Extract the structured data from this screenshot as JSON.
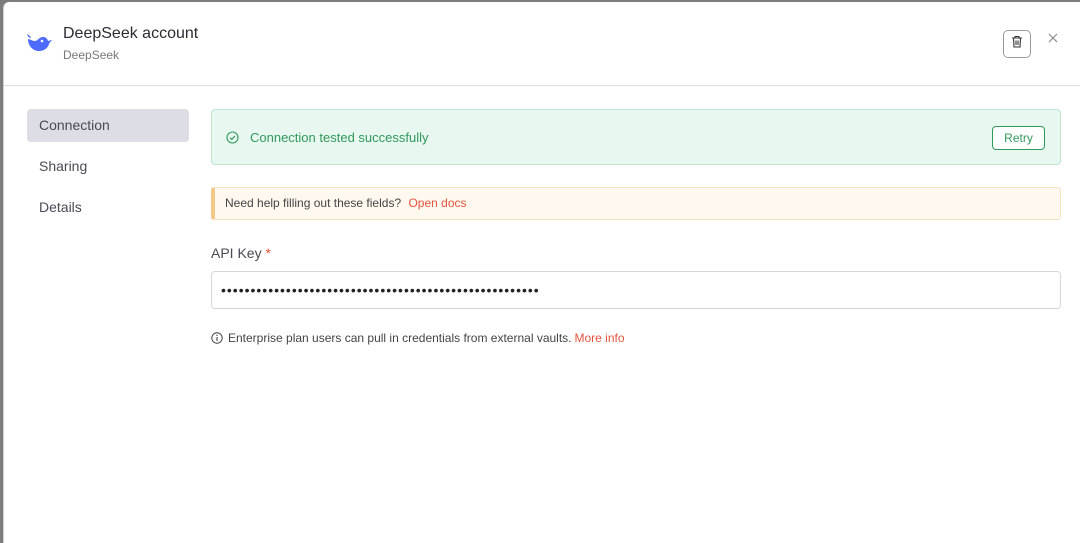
{
  "header": {
    "title": "DeepSeek account",
    "subtitle": "DeepSeek",
    "logo_icon": "whale-logo-icon",
    "trash_icon": "trash-icon",
    "close_icon": "close-icon"
  },
  "sidebar": {
    "items": [
      {
        "label": "Connection",
        "active": true
      },
      {
        "label": "Sharing",
        "active": false
      },
      {
        "label": "Details",
        "active": false
      }
    ]
  },
  "main": {
    "success": {
      "icon": "check-circle-icon",
      "message": "Connection tested successfully",
      "retry_label": "Retry"
    },
    "help": {
      "text": "Need help filling out these fields?",
      "link": "Open docs"
    },
    "api_key": {
      "label": "API Key",
      "required_mark": "*",
      "value": "••••••••••••••••••••••••••••••••••••••••••••••••••••••"
    },
    "hint": {
      "icon": "info-icon",
      "text": "Enterprise plan users can pull in credentials from external vaults.",
      "link": "More info"
    }
  },
  "colors": {
    "accent_link": "#e5533d",
    "success_green": "#2f9a5c",
    "success_bg": "#e8f7ef",
    "warning_bg": "#fef8ef",
    "active_nav_bg": "#dcdde5",
    "logo_blue": "#4d6bfe"
  }
}
